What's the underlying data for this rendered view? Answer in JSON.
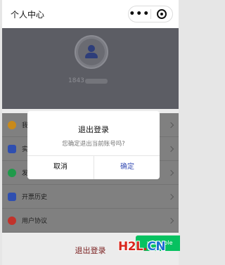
{
  "nav": {
    "title": "个人中心",
    "more_glyph": "•••",
    "icons": [
      "more-icon",
      "mini-program-close-icon"
    ]
  },
  "profile": {
    "phone_prefix": "1843",
    "avatar_icon": "user-avatar-icon"
  },
  "menu": {
    "items": [
      {
        "label": "我",
        "icon": "coin-icon",
        "color": "#c98a1a"
      },
      {
        "label": "实",
        "icon": "id-card-icon",
        "color": "#2f4fb0"
      },
      {
        "label": "发",
        "icon": "wechat-icon",
        "color": "#1f9a4a"
      },
      {
        "label": "开票历史",
        "icon": "invoice-history-icon",
        "color": "#2f4fb0"
      },
      {
        "label": "用户协议",
        "icon": "agreement-icon",
        "color": "#c2332b"
      }
    ]
  },
  "logout_label": "退出登录",
  "dialog": {
    "title": "退出登录",
    "message": "您确定退出当前账号吗?",
    "cancel_label": "取消",
    "confirm_label": "确定"
  },
  "vconsole_label": "vConsole",
  "watermark": {
    "part1": "H2L",
    "part2": ".",
    "part3": "CN"
  },
  "colors": {
    "accent": "#3a50b5",
    "vconsole": "#07c160",
    "header_bg": "#5c5d64"
  }
}
